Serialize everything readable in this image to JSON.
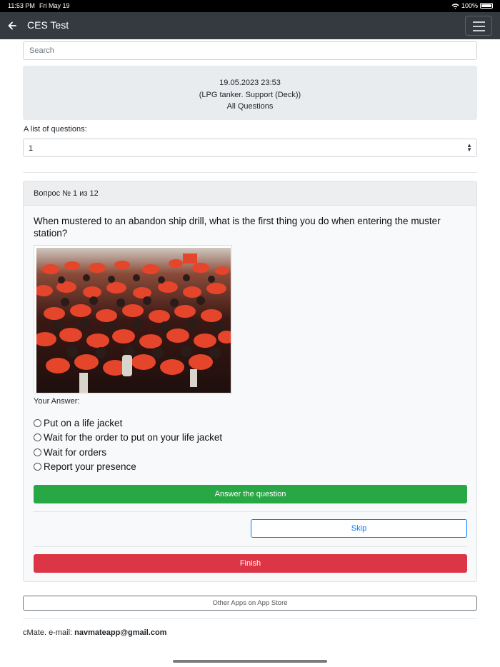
{
  "status_bar": {
    "time": "11:53 PM",
    "date": "Fri May 19",
    "battery": "100%"
  },
  "navbar": {
    "title": "CES Test"
  },
  "search": {
    "placeholder": "Search"
  },
  "info": {
    "datetime": "19.05.2023 23:53",
    "category": "(LPG tanker. Support (Deck))",
    "scope": "All Questions"
  },
  "question_list": {
    "label": "A list of questions:",
    "selected": "1"
  },
  "card": {
    "header": "Вопрос № 1 из 12",
    "question": "When mustered to an abandon ship drill, what is the first thing you do when entering the muster station?",
    "your_answer_label": "Your Answer:",
    "options": [
      "Put on a life jacket",
      "Wait for the order to put on your life jacket",
      "Wait for orders",
      "Report your presence"
    ],
    "answer_button": "Answer the question",
    "skip_button": "Skip",
    "finish_button": "Finish"
  },
  "other_apps_button": "Other Apps on App Store",
  "footer": {
    "prefix": "cMate. e-mail: ",
    "email": "navmateapp@gmail.com"
  },
  "colors": {
    "navbar": "#343a40",
    "success": "#28a745",
    "primary": "#007bff",
    "danger": "#dc3545"
  }
}
